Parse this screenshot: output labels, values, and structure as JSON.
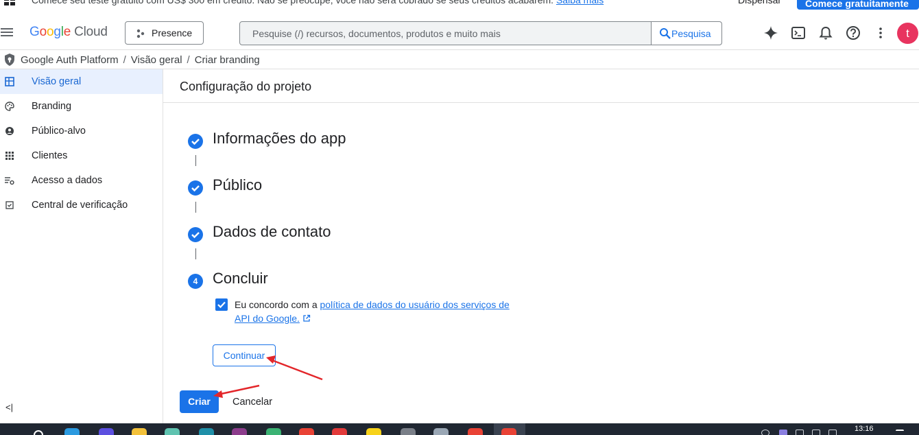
{
  "promo": {
    "message": "Comece seu teste gratuito com US$ 300 em crédito. Não se preocupe, você não será cobrado se seus créditos acabarem.",
    "link": "Saiba mais",
    "dismiss": "Dispensar",
    "start": "Comece gratuitamente"
  },
  "header": {
    "logo_google": "Google",
    "logo_cloud": "Cloud",
    "project": "Presence",
    "search_placeholder": "Pesquise (/) recursos, documentos, produtos e muito mais",
    "search_button": "Pesquisa",
    "avatar_letter": "t"
  },
  "breadcrumb": {
    "items": [
      "Google Auth Platform",
      "Visão geral",
      "Criar branding"
    ],
    "separator": "/"
  },
  "sidebar": {
    "items": [
      {
        "label": "Visão geral",
        "icon": "dashboard-icon",
        "active": true
      },
      {
        "label": "Branding",
        "icon": "palette-icon",
        "active": false
      },
      {
        "label": "Público-alvo",
        "icon": "person-icon",
        "active": false
      },
      {
        "label": "Clientes",
        "icon": "apps-grid-icon",
        "active": false
      },
      {
        "label": "Acesso a dados",
        "icon": "data-settings-icon",
        "active": false
      },
      {
        "label": "Central de verificação",
        "icon": "verified-box-icon",
        "active": false
      }
    ],
    "collapse": "<|"
  },
  "main": {
    "title": "Configuração do projeto",
    "steps": [
      {
        "title": "Informações do app",
        "state": "done"
      },
      {
        "title": "Público",
        "state": "done"
      },
      {
        "title": "Dados de contato",
        "state": "done"
      },
      {
        "title": "Concluir",
        "state": "current",
        "number": "4"
      }
    ],
    "agree_prefix": "Eu concordo com a",
    "agree_link": "política de dados do usuário dos serviços de API do Google.",
    "agree_checked": true,
    "continue_button": "Continuar",
    "create_button": "Criar",
    "cancel_button": "Cancelar"
  },
  "taskbar": {
    "clock": "13:16"
  },
  "colors": {
    "accent": "#1a73e8",
    "annotation_arrow": "#e3262a",
    "avatar": "#e8345f"
  }
}
